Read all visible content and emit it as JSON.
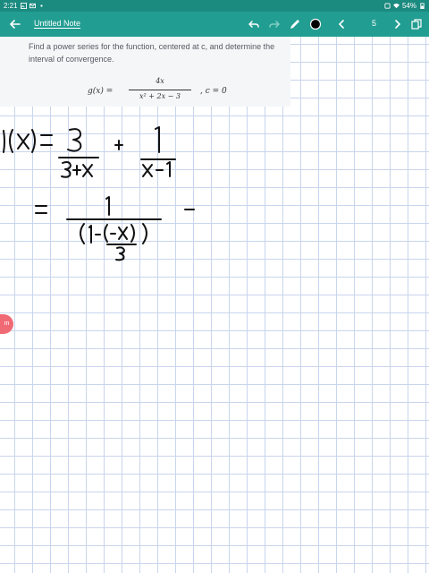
{
  "status_bar": {
    "time": "2:21",
    "battery": "54%"
  },
  "app_bar": {
    "title": "Untitled Note",
    "page_number": "5"
  },
  "problem": {
    "text": "Find a power series for the function, centered at c, and determine the interval of convergence.",
    "formula_lhs": "g(x) =",
    "formula_num": "4x",
    "formula_den": "x² + 2x − 3",
    "formula_c": ",    c = 0"
  },
  "side_tab": {
    "label": "m"
  },
  "colors": {
    "status_bar": "#1b8a7f",
    "app_bar": "#229d91",
    "grid": "#c9d5ec",
    "side_tab": "#f06a75",
    "pen_color": "#000000"
  },
  "icons": [
    "back-arrow-icon",
    "undo-icon",
    "redo-icon",
    "pen-icon",
    "color-swatch-icon",
    "prev-page-icon",
    "next-page-icon",
    "copy-pages-icon"
  ]
}
